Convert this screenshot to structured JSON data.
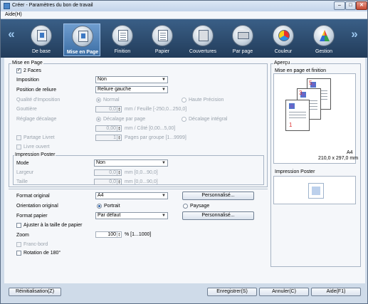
{
  "window": {
    "title": "Créer - Paramètres du bon de travail",
    "close_glyph": "✕",
    "max_glyph": "□",
    "min_glyph": "–"
  },
  "menubar": {
    "help": "Aide(H)"
  },
  "toolbar": {
    "left_arrow": "«",
    "right_arrow": "»",
    "items": [
      {
        "label": "De base",
        "icon": "basic-icon"
      },
      {
        "label": "Mise en Page",
        "icon": "layout-icon",
        "active": true
      },
      {
        "label": "Finition",
        "icon": "finishing-icon"
      },
      {
        "label": "Papier",
        "icon": "paper-icon"
      },
      {
        "label": "Couvertures",
        "icon": "covers-icon"
      },
      {
        "label": "Par page",
        "icon": "per-page-icon"
      },
      {
        "label": "Couleur",
        "icon": "color-icon"
      },
      {
        "label": "Gestion",
        "icon": "management-icon"
      }
    ]
  },
  "layout": {
    "group_title": "Mise en Page",
    "two_sided": {
      "label": "2 Faces",
      "checked": true
    },
    "imposition": {
      "label": "Imposition",
      "value": "Non"
    },
    "binding": {
      "label": "Position de reliure",
      "value": "Reliure gauche"
    },
    "imposition_quality": {
      "label": "Qualité d'Imposition",
      "option1": "Normal",
      "option2": "Haute Précision"
    },
    "gutter": {
      "label": "Gouttière",
      "value": "0,0",
      "unit": "mm / Feuille [-250,0...250,0]"
    },
    "shift": {
      "label": "Réglage décalage",
      "option1": "Décalage par page",
      "option2": "Décalage intégral",
      "value": "0,00",
      "unit": "mm / Côté [0,00...5,00]"
    },
    "booklet_split": {
      "label": "Partage Livret",
      "value": "1",
      "unit": "Pages par groupe [1...9999]"
    },
    "open_book": {
      "label": "Livre ouvert"
    }
  },
  "poster": {
    "group_title": "Impression Poster",
    "mode": {
      "label": "Mode",
      "value": "Non"
    },
    "width": {
      "label": "Largeur",
      "value": "0,0",
      "unit": "mm [0,0...90,0]"
    },
    "height": {
      "label": "Taille",
      "value": "0,0",
      "unit": "mm [0,0...90,0]"
    }
  },
  "original": {
    "format": {
      "label": "Format original",
      "value": "A4",
      "custom": "Personnalisé..."
    },
    "orientation": {
      "label": "Orientation original",
      "portrait": "Portrait",
      "landscape": "Paysage"
    },
    "paper": {
      "label": "Format papier",
      "value": "Par défaut",
      "custom": "Personnalisé..."
    },
    "fit": {
      "label": "Ajuster à la taille de papier"
    },
    "zoom": {
      "label": "Zoom",
      "value": "100",
      "unit": "% [1...1000]"
    },
    "bleed": {
      "label": "Franc-bord"
    },
    "rotate": {
      "label": "Rotation de 180°"
    }
  },
  "preview": {
    "group_title": "Aperçu",
    "layout_title": "Mise en page et finition",
    "page_nums": [
      "5",
      "3",
      "1"
    ],
    "paper_name": "A4",
    "paper_size": "210,0 x 297,0 mm",
    "poster_title": "Impression Poster"
  },
  "footer": {
    "reset": "Réinitialisation(Z)",
    "save": "Enregistrer(S)",
    "cancel": "Annuler(C)",
    "help": "Aide(F1)"
  }
}
